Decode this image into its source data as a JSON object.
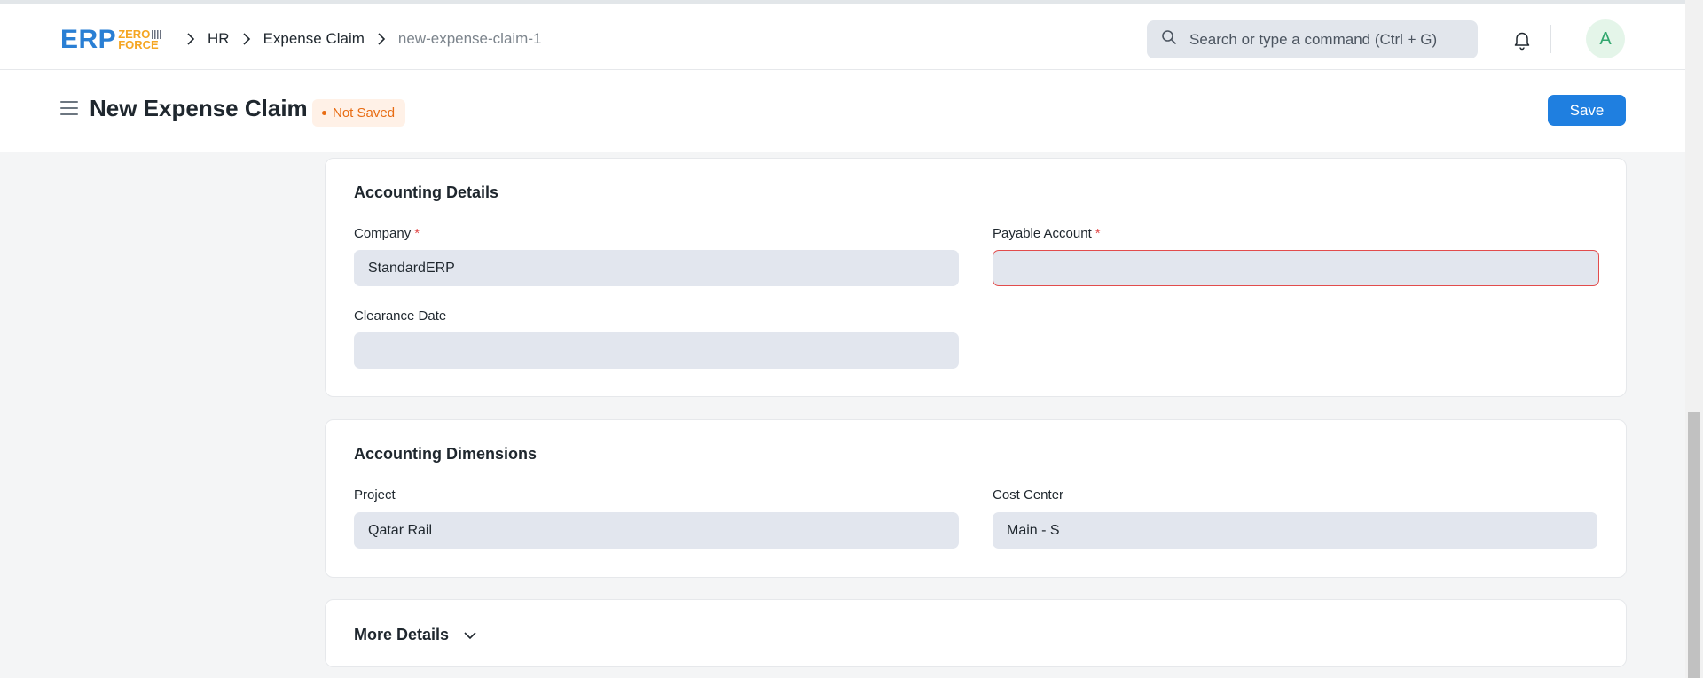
{
  "brand": {
    "logo_main": "ERP",
    "logo_line1": "ZERO",
    "logo_line2": "FORCE"
  },
  "breadcrumb": {
    "items": [
      "HR",
      "Expense Claim"
    ],
    "current": "new-expense-claim-1"
  },
  "search": {
    "placeholder": "Search or type a command (Ctrl + G)"
  },
  "user": {
    "avatar_initial": "A"
  },
  "page": {
    "title": "New Expense Claim",
    "status": "Not Saved",
    "save_label": "Save"
  },
  "accounting_details": {
    "title": "Accounting Details",
    "company_label": "Company",
    "company_value": "StandardERP",
    "payable_account_label": "Payable Account",
    "payable_account_value": "",
    "clearance_date_label": "Clearance Date",
    "clearance_date_value": "",
    "required_mark": "*"
  },
  "accounting_dimensions": {
    "title": "Accounting Dimensions",
    "project_label": "Project",
    "project_value": "Qatar Rail",
    "cost_center_label": "Cost Center",
    "cost_center_value": "Main - S"
  },
  "more_details": {
    "title": "More Details"
  },
  "colors": {
    "primary": "#1f7fe0",
    "warning": "#e86c13",
    "error": "#e24c4c",
    "logo_blue": "#2a7fd4",
    "logo_orange": "#f5a623"
  },
  "icons": [
    "search-icon",
    "bell-icon",
    "hamburger-icon",
    "chevron-right-icon",
    "chevron-down-icon"
  ]
}
